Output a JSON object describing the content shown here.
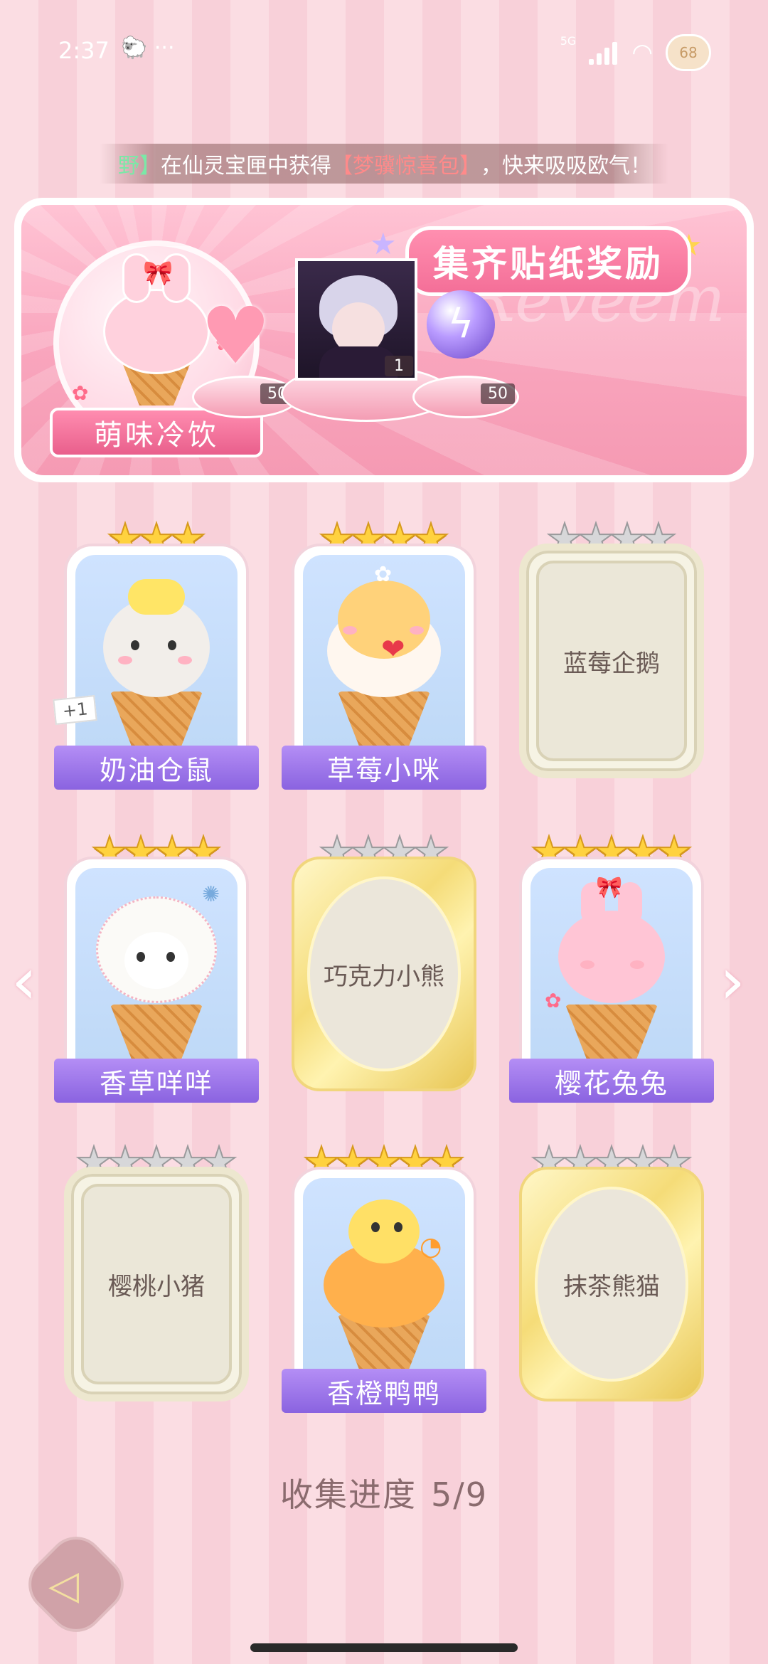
{
  "status": {
    "time": "2:37",
    "extra": "🐑 ···",
    "network": "5G",
    "battery": "68"
  },
  "ticker": {
    "prefix": "野】",
    "middle": "在仙灵宝匣中获得",
    "item": "【梦骥惊喜包】",
    "suffix": "，快来吸吸欧气！"
  },
  "banner": {
    "title": "集齐贴纸奖励",
    "watermark": "Reveem",
    "collection_name": "萌味冷饮",
    "rewards": [
      {
        "icon": "pink-heart-gem-icon",
        "count": "50"
      },
      {
        "icon": "character-portrait",
        "count": "1"
      },
      {
        "icon": "lightning-orb-icon",
        "count": "50"
      }
    ]
  },
  "cards": [
    {
      "name": "奶油仓鼠",
      "stars": 3,
      "state": "unlocked",
      "badge": "+1",
      "scoop": "#f2eeea",
      "topping": "#ffe566"
    },
    {
      "name": "草莓小咪",
      "stars": 4,
      "state": "unlocked",
      "badge": "",
      "scoop": "#ffd27a",
      "topping": "#e8394a"
    },
    {
      "name": "蓝莓企鹅",
      "stars": 4,
      "state": "locked-plain",
      "badge": ""
    },
    {
      "name": "香草咩咩",
      "stars": 4,
      "state": "unlocked",
      "badge": "",
      "scoop": "#fbfaf7",
      "topping": "#f7c94f"
    },
    {
      "name": "巧克力小熊",
      "stars": 4,
      "state": "locked-gold",
      "badge": ""
    },
    {
      "name": "樱花兔兔",
      "stars": 5,
      "state": "unlocked",
      "badge": "",
      "scoop": "#ffc5d5",
      "topping": "#ffd23f"
    },
    {
      "name": "樱桃小猪",
      "stars": 5,
      "state": "locked-plain",
      "badge": ""
    },
    {
      "name": "香橙鸭鸭",
      "stars": 5,
      "state": "unlocked",
      "badge": "",
      "scoop": "#ffb04c",
      "topping": "#ffe066"
    },
    {
      "name": "抹茶熊猫",
      "stars": 5,
      "state": "locked-gold",
      "badge": ""
    }
  ],
  "progress": {
    "label": "收集进度",
    "value": "5/9",
    "collected": 5,
    "total": 9
  },
  "colors": {
    "gold_star": "#ffd23f",
    "grey_star": "#d7d7d9",
    "label_purple": "#8a63e0",
    "pink_banner": "#f59ab3"
  }
}
